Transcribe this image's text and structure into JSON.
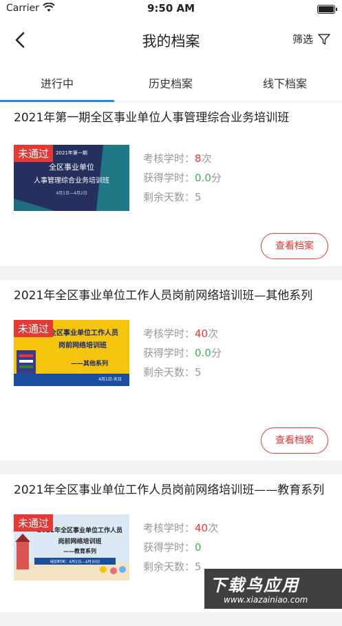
{
  "status_bar": {
    "carrier": "Carrier",
    "time": "9:50 AM"
  },
  "header": {
    "title": "我的档案",
    "filter_label": "筛选"
  },
  "tabs": [
    {
      "label": "进行中",
      "active": true
    },
    {
      "label": "历史档案",
      "active": false
    },
    {
      "label": "线下档案",
      "active": false
    }
  ],
  "cards": [
    {
      "title": "2021年第一期全区事业单位人事管理综合业务培训班",
      "badge": "未通过",
      "thumb_lines": [
        "2021年第一期",
        "全区事业单位",
        "人事管理综合业务培训班",
        "4月1日—4月2日"
      ],
      "required_label": "考核学时：",
      "required_value": "8",
      "required_unit": "次",
      "earned_label": "获得学时：",
      "earned_value": "0.0",
      "earned_unit": "分",
      "days_label": "剩余天数：",
      "days_value": "5",
      "button": "查看档案"
    },
    {
      "title": "2021年全区事业单位工作人员岗前网络培训班—其他系列",
      "badge": "未通过",
      "thumb_lines": [
        "全区事业单位工作人员",
        "岗前网络培训班",
        "——其他系列",
        "4月1日-天日"
      ],
      "required_label": "考核学时：",
      "required_value": "40",
      "required_unit": "次",
      "earned_label": "获得学时：",
      "earned_value": "0.0",
      "earned_unit": "分",
      "days_label": "剩余天数：",
      "days_value": "5",
      "button": "查看档案"
    },
    {
      "title": "2021年全区事业单位工作人员岗前网络培训班——教育系列",
      "badge": "未通过",
      "thumb_lines": [
        "2021年全区事业单位工作人员",
        "岗前网络培训班",
        "——教育系列",
        "培训时间：4月1日—4月30日"
      ],
      "required_label": "考核学时：",
      "required_value": "40",
      "required_unit": "次",
      "earned_label": "获得学时：",
      "earned_value": "0",
      "earned_unit": "",
      "days_label": "剩余天数：",
      "days_value": "5",
      "button": "查看档案"
    }
  ],
  "watermark": {
    "main": "下载鸟应用",
    "url": "www.xiazainiao.com"
  }
}
